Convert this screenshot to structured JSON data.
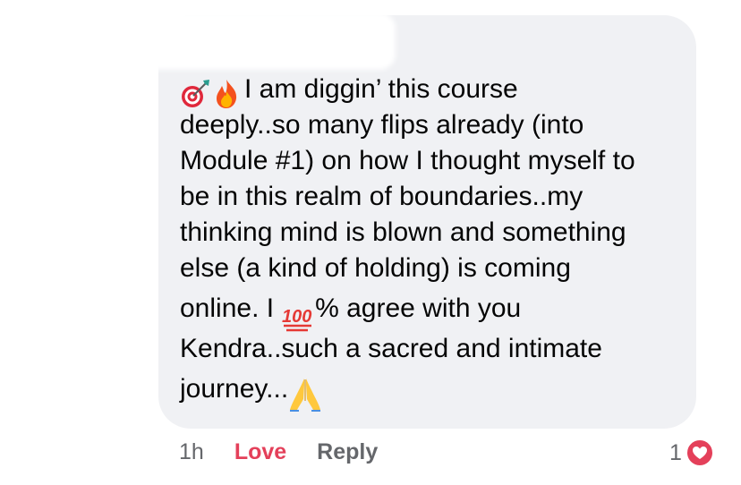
{
  "comment": {
    "line1": "I am diggin’ this course",
    "line2": "deeply..so many flips already (into",
    "line3": "Module #1) on how I thought myself to",
    "line4": "be in this realm of boundaries..my",
    "line5": "thinking mind is blown and something",
    "line6": "else (a kind of holding) is coming",
    "line7_before": "online. I",
    "line7_after": "% agree with you",
    "line8": "Kendra..such a sacred and intimate",
    "line9": "journey...",
    "emojis": [
      "bullseye-icon",
      "fire-icon",
      "hundred-points-icon",
      "folded-hands-icon"
    ]
  },
  "footer": {
    "time": "1h",
    "love_label": "Love",
    "reply_label": "Reply"
  },
  "reactions": {
    "count": "1",
    "type": "love-heart-icon",
    "color": "#e4405a"
  },
  "colors": {
    "bubble": "#f0f1f4",
    "text": "#050505",
    "secondary": "#65676b",
    "love": "#e4405a"
  }
}
